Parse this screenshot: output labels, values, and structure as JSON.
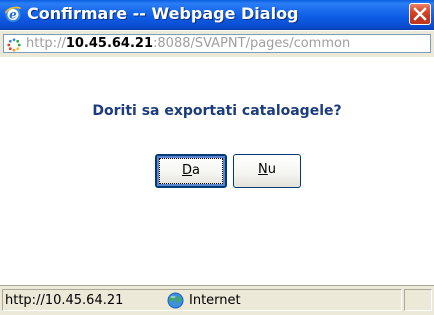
{
  "window": {
    "title": "Confirmare -- Webpage Dialog",
    "close_icon": "close-icon"
  },
  "address": {
    "prefix": "http://",
    "host": "10.45.64.21",
    "rest": ":8088/SVAPNT/pages/common"
  },
  "dialog": {
    "question": "Doriti sa exportati cataloagele?",
    "buttons": {
      "da": {
        "accel": "D",
        "rest": "a"
      },
      "nu": {
        "accel": "N",
        "rest": "u"
      }
    }
  },
  "status": {
    "url": "http://10.45.64.21",
    "zone": "Internet"
  },
  "colors": {
    "titlebar": "#0b56dc",
    "question_text": "#1c3c7c",
    "chrome": "#ece9d8",
    "close_button": "#d9492a"
  }
}
